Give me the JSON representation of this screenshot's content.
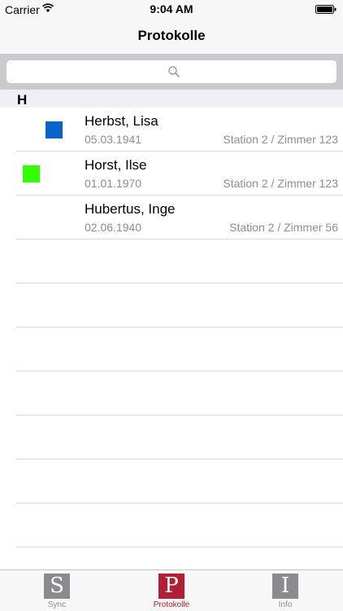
{
  "status_bar": {
    "carrier": "Carrier",
    "time": "9:04 AM"
  },
  "nav": {
    "title": "Protokolle"
  },
  "search": {
    "placeholder": ""
  },
  "section": {
    "letter": "H"
  },
  "rows": [
    {
      "name": "Herbst, Lisa",
      "date": "05.03.1941",
      "location": "Station 2 / Zimmer 123",
      "marker_color": "#0a63c9"
    },
    {
      "name": "Horst, Ilse",
      "date": "01.01.1970",
      "location": "Station 2 / Zimmer 123",
      "marker_color": "#33ff00"
    },
    {
      "name": "Hubertus, Inge",
      "date": "02.06.1940",
      "location": "Station 2 / Zimmer 56",
      "marker_color": ""
    }
  ],
  "tabs": [
    {
      "letter": "S",
      "label": "Sync",
      "color": "#8a8a8f",
      "active": false
    },
    {
      "letter": "P",
      "label": "Protokolle",
      "color": "#b21e35",
      "active": true
    },
    {
      "letter": "I",
      "label": "Info",
      "color": "#8a8a8f",
      "active": false
    }
  ],
  "colors": {
    "accent": "#b21e35",
    "background": "#f7f7f7",
    "search_bar": "#c9c9ce"
  }
}
